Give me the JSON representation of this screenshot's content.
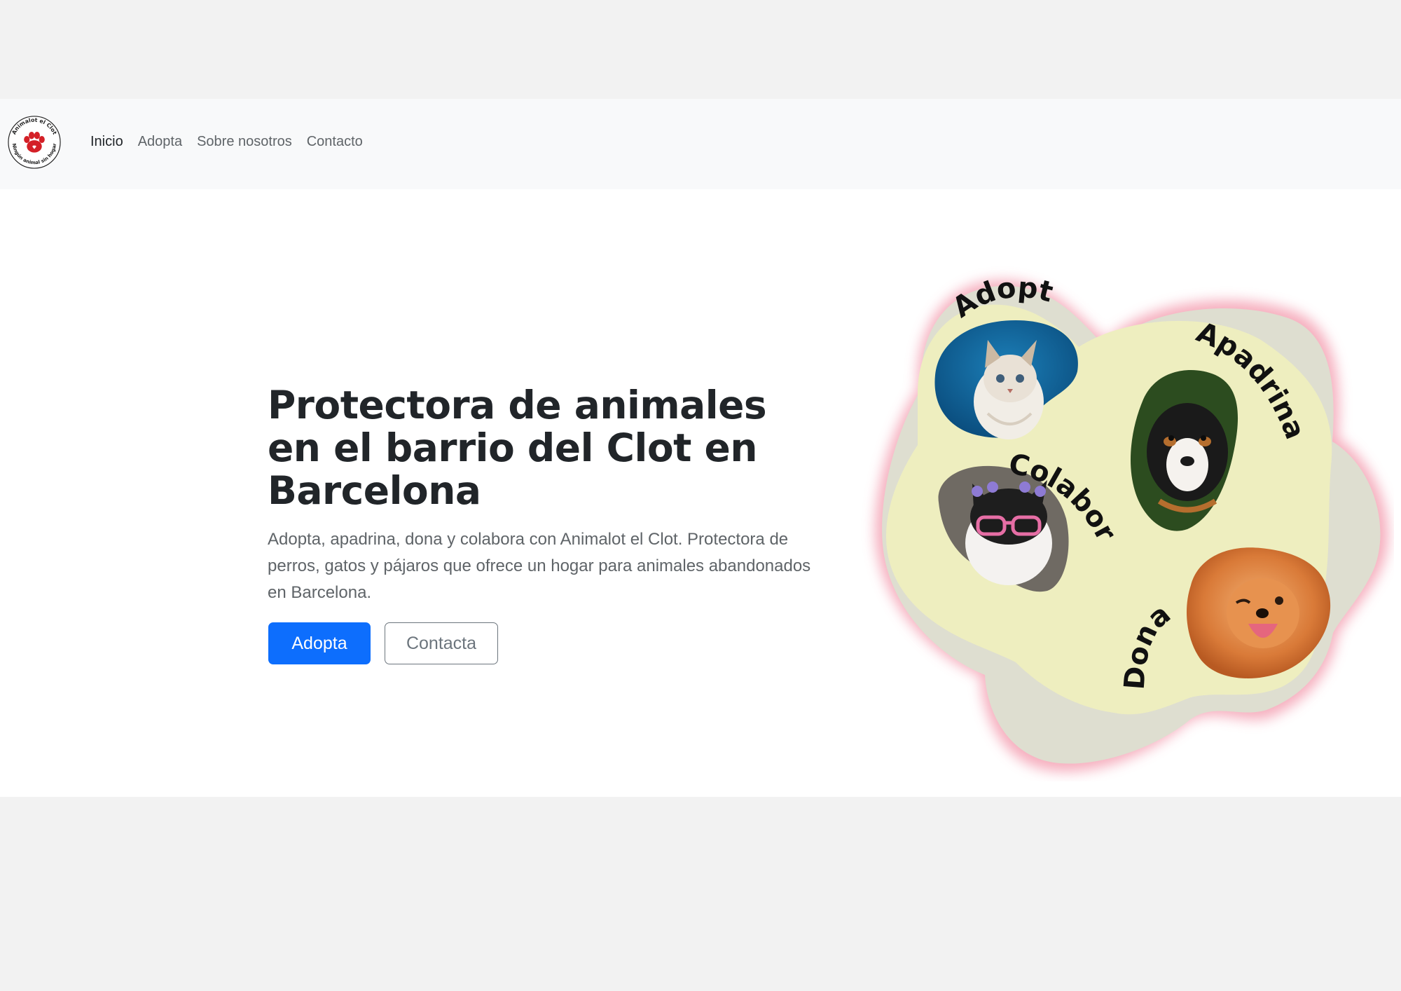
{
  "navbar": {
    "logo_text_top": "Animalot el Clot",
    "logo_text_bottom": "Ningún animal sin hogar",
    "links": [
      {
        "label": "Inicio",
        "active": true
      },
      {
        "label": "Adopta",
        "active": false
      },
      {
        "label": "Sobre nosotros",
        "active": false
      },
      {
        "label": "Contacto",
        "active": false
      }
    ]
  },
  "hero": {
    "title": "Protectora de animales en el barrio del Clot en Barcelona",
    "lead": "Adopta, apadrina, dona y colabora con Animalot el Clot. Protectora de perros, gatos y pájaros que ofrece un hogar para animales abandonados en Barcelona.",
    "primary_button": "Adopta",
    "secondary_button": "Contacta"
  },
  "illustration": {
    "labels": {
      "adopta": "Adopta",
      "apadrina": "Apadrina",
      "colabora": "Colabora",
      "dona": "Dona"
    },
    "photos": [
      "cat-photo",
      "puppy-photo",
      "cat-sunglasses-photo",
      "pomeranian-photo"
    ]
  },
  "colors": {
    "primary": "#0d6efd",
    "navbar_bg": "#f8f9fa",
    "blob_yellow": "#eeeebf",
    "blob_gray": "#deded0",
    "glow_pink": "#f2a0b0"
  }
}
